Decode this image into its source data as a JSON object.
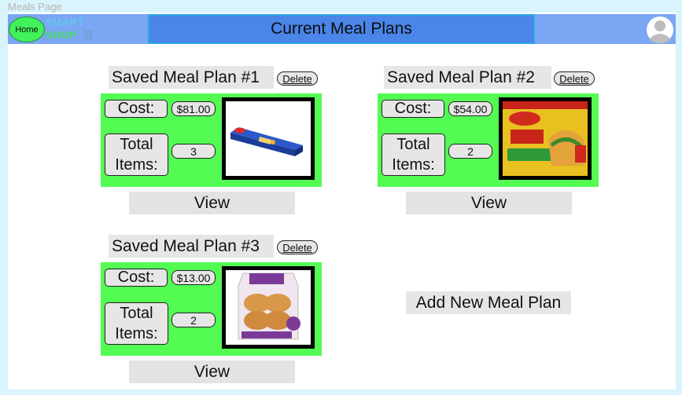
{
  "page": {
    "label": "Meals Page"
  },
  "header": {
    "home_label": "Home",
    "logo_line1": "SMART",
    "logo_line2": "SHOP",
    "title": "Current Meal Plans",
    "avatar_icon": "user-avatar-icon"
  },
  "plans": [
    {
      "title": "Saved Meal Plan #1",
      "delete_label": "Delete",
      "cost_label": "Cost:",
      "cost": "$81.00",
      "items_label": "Total Items:",
      "items": "3",
      "image_icon": "spaghetti-box",
      "view_label": "View"
    },
    {
      "title": "Saved Meal Plan #2",
      "delete_label": "Delete",
      "cost_label": "Cost:",
      "cost": "$54.00",
      "items_label": "Total Items:",
      "items": "2",
      "image_icon": "taco-shells-box",
      "view_label": "View"
    },
    {
      "title": "Saved Meal Plan #3",
      "delete_label": "Delete",
      "cost_label": "Cost:",
      "cost": "$13.00",
      "items_label": "Total Items:",
      "items": "2",
      "image_icon": "burger-buns-bag",
      "view_label": "View"
    }
  ],
  "add_plan_label": "Add New Meal Plan",
  "colors": {
    "topbar": "#7aa6f3",
    "title_box": "#4a85e8",
    "card": "#53fb53",
    "home": "#41f25a",
    "background": "#d9f4fd"
  }
}
